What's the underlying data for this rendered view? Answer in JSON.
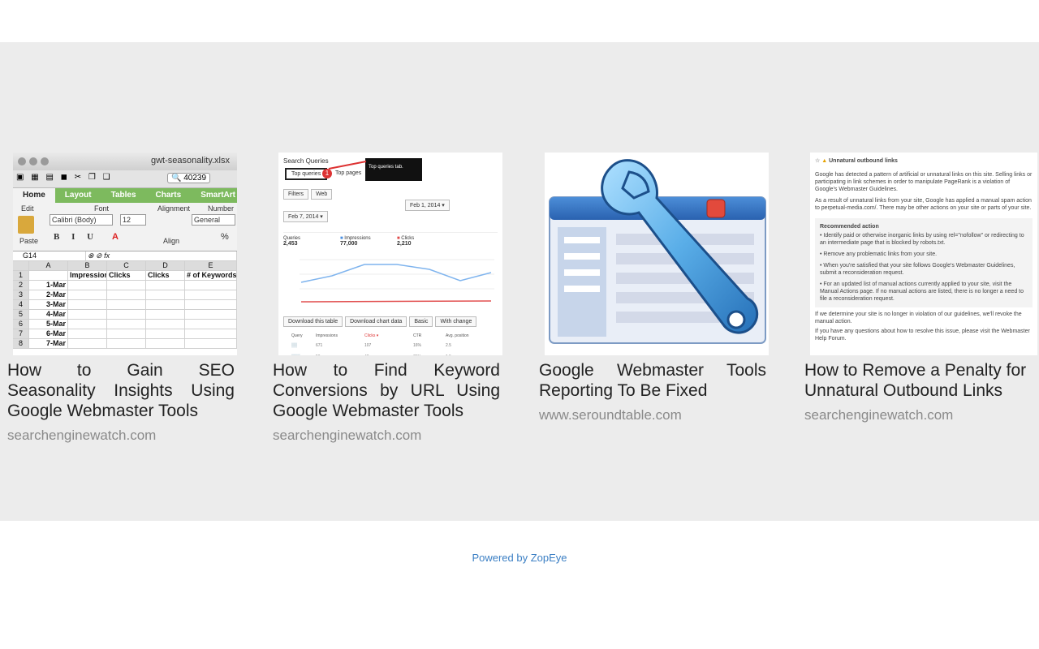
{
  "cards": [
    {
      "title": "How to Gain SEO Seasonality Insights Using Google Webmaster Tools",
      "source": "searchenginewatch.com",
      "thumb": {
        "filename": "gwt-seasonality.xlsx",
        "search_value": "40239",
        "tabs": [
          "Home",
          "Layout",
          "Tables",
          "Charts",
          "SmartArt"
        ],
        "font_name": "Calibri (Body)",
        "font_size": "12",
        "number_format": "General",
        "cell_ref": "G14",
        "col_letters": [
          "A",
          "B",
          "C",
          "D",
          "E"
        ],
        "headers": [
          "",
          "Impressions",
          "Clicks",
          "Clicks",
          "# of Keywords"
        ],
        "rows": [
          "1-Mar",
          "2-Mar",
          "3-Mar",
          "4-Mar",
          "5-Mar",
          "6-Mar",
          "7-Mar"
        ],
        "ribbon_labels": [
          "Edit",
          "Font",
          "Alignment",
          "Number",
          "Paste",
          "Align"
        ]
      }
    },
    {
      "title": "How to Find Keyword Conversions by URL Using Google Webmaster Tools",
      "source": "searchenginewatch.com",
      "thumb": {
        "heading": "Search Queries",
        "tab_1": "Top queries",
        "tab_2": "Top pages",
        "callout": "Top queries tab.",
        "stat_1_label": "Queries",
        "stat_1_value": "2,453",
        "stat_2_label": "Impressions",
        "stat_2_value": "77,000",
        "stat_3_label": "Clicks",
        "stat_3_value": "2,210"
      }
    },
    {
      "title": "Google Webmaster Tools Reporting To Be Fixed",
      "source": "www.seroundtable.com"
    },
    {
      "title": "How to Remove a Penalty for Unnatural Outbound Links",
      "source": "searchenginewatch.com",
      "thumb": {
        "heading": "Unnatural outbound links",
        "para_1": "Google has detected a pattern of artificial or unnatural links on this site. Selling links or participating in link schemes in order to manipulate PageRank is a violation of Google's Webmaster Guidelines.",
        "para_2": "As a result of unnatural links from your site, Google has applied a manual spam action to perpetual-media.com/. There may be other actions on your site or parts of your site.",
        "box_heading": "Recommended action",
        "bullet_1": "Identify paid or otherwise inorganic links by using rel=\"nofollow\" or redirecting to an intermediate page that is blocked by robots.txt.",
        "bullet_2": "Remove any problematic links from your site.",
        "bullet_3": "When you're satisfied that your site follows Google's Webmaster Guidelines, submit a reconsideration request.",
        "bullet_4": "For an updated list of manual actions currently applied to your site, visit the Manual Actions page. If no manual actions are listed, there is no longer a need to file a reconsideration request.",
        "para_3": "If we determine your site is no longer in violation of our guidelines, we'll revoke the manual action.",
        "para_4": "If you have any questions about how to resolve this issue, please visit the Webmaster Help Forum."
      }
    }
  ],
  "footer": {
    "prefix": "Powered by ",
    "brand": "ZopEye"
  },
  "colors": {
    "band": "#ececec",
    "title": "#222222",
    "source": "#8a8a8a",
    "link": "#3b7fc4"
  }
}
